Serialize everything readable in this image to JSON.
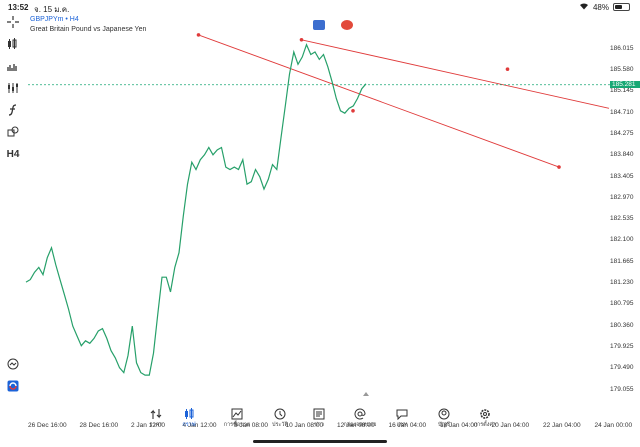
{
  "status": {
    "time": "13:52",
    "date": "จ. 15 ม.ค.",
    "battery": "48%"
  },
  "chart": {
    "symbol": "GBPJPYm • H4",
    "description": "Great Britain Pound vs Japanese Yen",
    "current_price": "185.281"
  },
  "price_axis": [
    "186.015",
    "185.580",
    "185.145",
    "184.710",
    "184.275",
    "183.840",
    "183.405",
    "182.970",
    "182.535",
    "182.100",
    "181.665",
    "181.230",
    "180.795",
    "180.360",
    "179.925",
    "179.490",
    "179.055"
  ],
  "time_axis": [
    "26 Dec 16:00",
    "28 Dec 16:00",
    "2 Jan 12:00",
    "4 Jan 12:00",
    "8 Jan 08:00",
    "10 Jan 08:00",
    "12 Jan 08:00",
    "16 Jan 04:00",
    "18 Jan 04:00",
    "20 Jan 04:00",
    "22 Jan 04:00",
    "24 Jan 00:00"
  ],
  "toolbar": [
    "crosshair-icon",
    "chart-type-icon",
    "indicators-icon",
    "price-levels-icon",
    "function-icon",
    "objects-icon",
    "H4"
  ],
  "nav": [
    {
      "label": "ราคา",
      "icon": "quotes-icon",
      "active": false
    },
    {
      "label": "กราฟ",
      "icon": "chart-icon",
      "active": true
    },
    {
      "label": "การซื้อขาย",
      "icon": "trade-icon",
      "active": false
    },
    {
      "label": "ประวัติ",
      "icon": "history-icon",
      "active": false
    },
    {
      "label": "ข่าว",
      "icon": "news-icon",
      "active": false
    },
    {
      "label": "กล่องจดหมาย",
      "icon": "mailbox-icon",
      "active": false
    },
    {
      "label": "แชท",
      "icon": "chat-icon",
      "active": false
    },
    {
      "label": "บัญชี",
      "icon": "account-icon",
      "active": false
    },
    {
      "label": "การตั้งค่า",
      "icon": "settings-icon",
      "active": false
    }
  ],
  "colors": {
    "line": "#27a06a",
    "trend": "#e03b3b",
    "accent": "#1c63d8",
    "current": "#18a874"
  },
  "chart_data": {
    "type": "line",
    "series": [
      {
        "values": [
          181.25,
          181.3,
          181.45,
          181.55,
          181.4,
          181.75,
          181.95,
          181.6,
          181.3,
          181.0,
          180.7,
          180.35,
          180.15,
          179.95,
          180.05,
          180.0,
          180.1,
          180.25,
          180.3,
          180.1,
          179.85,
          179.7,
          179.5,
          179.4,
          179.75,
          180.35,
          179.6,
          179.4,
          179.35,
          179.35,
          179.8,
          180.6,
          181.35,
          181.35,
          181.05,
          181.55,
          181.85,
          182.6,
          183.25,
          183.7,
          183.55,
          183.75,
          183.85,
          184.0,
          183.85,
          183.95,
          184.0,
          183.6,
          183.55,
          183.6,
          183.55,
          183.75,
          183.25,
          183.3,
          183.55,
          183.4,
          183.15,
          183.35,
          183.65,
          183.55,
          184.2,
          184.85,
          185.5,
          185.95,
          185.7,
          185.85,
          186.1,
          185.9,
          185.95,
          185.8,
          185.9,
          185.65,
          185.35,
          185.0,
          184.75,
          184.7,
          184.8,
          184.85,
          185.0,
          185.2,
          185.3
        ]
      }
    ],
    "trendlines": [
      {
        "from": [
          "4 Jan 12:00",
          186.3
        ],
        "to": [
          "22 Jan 04:00",
          183.6
        ],
        "markers": [
          {
            "x": "12 Jan 08:00",
            "y": 184.75
          }
        ]
      },
      {
        "from": [
          "10 Jan 08:00",
          186.2
        ],
        "to": [
          "24 Jan 00:00",
          184.8
        ],
        "markers": [
          {
            "x": "20 Jan 04:00",
            "y": 185.6
          }
        ]
      }
    ],
    "ylim": [
      178.8,
      186.4
    ],
    "current_price": 185.281
  }
}
